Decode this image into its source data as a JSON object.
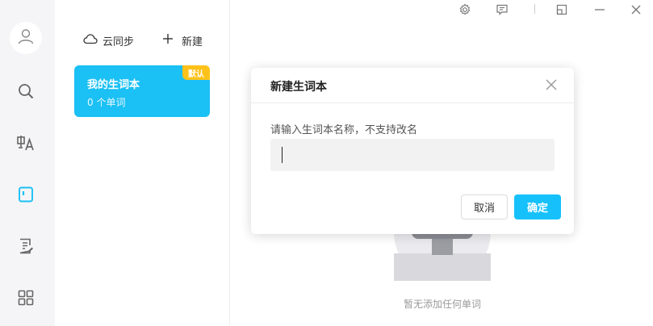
{
  "window_controls": {
    "settings_icon": "gear-icon",
    "feedback_icon": "message-icon",
    "restore_icon": "window-restore-icon",
    "minimize_icon": "minimize-icon",
    "close_icon": "close-icon"
  },
  "sidebar": {
    "items": [
      {
        "icon": "user-avatar-icon"
      },
      {
        "icon": "search-icon"
      },
      {
        "icon": "translate-icon"
      },
      {
        "icon": "wordbook-icon",
        "active": true
      },
      {
        "icon": "notes-edit-icon"
      },
      {
        "icon": "apps-grid-icon"
      }
    ],
    "active_color": "#1bc0f4"
  },
  "toolbar": {
    "cloud_sync_label": "云同步",
    "new_label": "新建"
  },
  "wordbooks": [
    {
      "name": "我的生词本",
      "count_text": "0 个单词",
      "badge": "默认"
    }
  ],
  "empty_state": {
    "text": "暂无添加任何单词"
  },
  "dialog": {
    "title": "新建生词本",
    "prompt": "请输入生词本名称，不支持改名",
    "input_value": "",
    "cancel_label": "取消",
    "confirm_label": "确定"
  },
  "colors": {
    "accent": "#1bc0f4",
    "badge": "#ffc21a",
    "rail_bg": "#f5f5f7"
  }
}
